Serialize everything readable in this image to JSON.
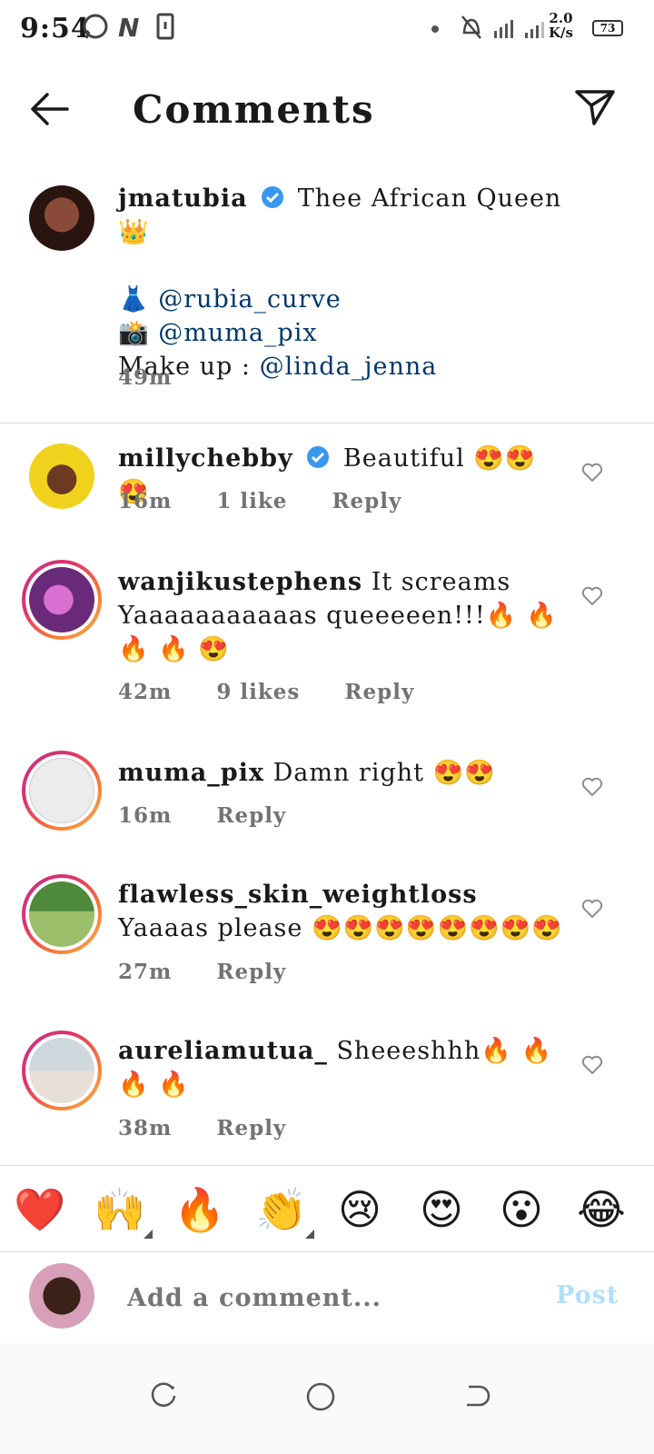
{
  "status_bar": {
    "time": "9:54",
    "network_speed": "2.0",
    "network_unit": "K/s",
    "battery": "73"
  },
  "header": {
    "title": "Comments"
  },
  "caption": {
    "username": "jmatubia",
    "text": "Thee African Queen 👑",
    "line1_emoji": "👗",
    "line1_mention": "@rubia_curve",
    "line2_emoji": "📸",
    "line2_mention": "@muma_pix",
    "line3_label": "Make up : ",
    "line3_mention": "@linda_jenna",
    "time": "49m"
  },
  "comments": [
    {
      "username": "millychebby",
      "text": "Beautiful 😍😍😍",
      "time": "16m",
      "likes": "1 like",
      "reply": "Reply"
    },
    {
      "username": "wanjikustephens",
      "text": "It screams Yaaaaaaaaaaas queeeeen!!!🔥 🔥 🔥 🔥 😍",
      "time": "42m",
      "likes": "9 likes",
      "reply": "Reply"
    },
    {
      "username": "muma_pix",
      "text": "Damn right 😍😍",
      "time": "16m",
      "reply": "Reply"
    },
    {
      "username": "flawless_skin_weightloss",
      "text": "Yaaaas please 😍😍😍😍😍😍😍😍",
      "time": "27m",
      "reply": "Reply"
    },
    {
      "username": "aureliamutua_",
      "text": "Sheeeshhh🔥 🔥 🔥 🔥",
      "time": "38m",
      "reply": "Reply"
    }
  ],
  "emoji_bar": [
    "❤️",
    "🙌",
    "🔥",
    "👏",
    "😢",
    "😍",
    "😮",
    "😂"
  ],
  "input": {
    "placeholder": "Add a comment...",
    "post_label": "Post"
  },
  "colors": {
    "mention": "#00376b",
    "verified": "#3897f0",
    "post_disabled": "#b2dffc",
    "meta": "#737373"
  }
}
